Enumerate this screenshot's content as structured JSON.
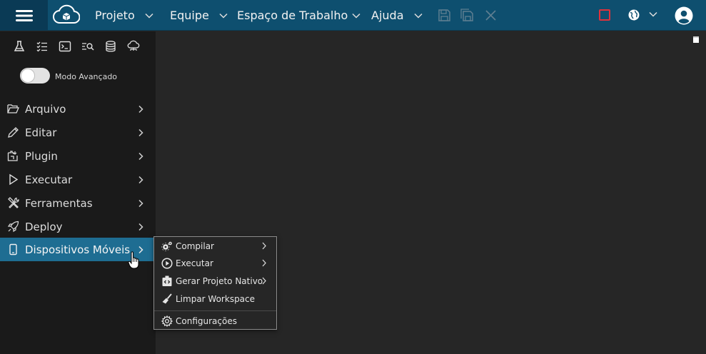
{
  "topbar": {
    "menus": [
      {
        "label": "Projeto"
      },
      {
        "label": "Equipe"
      },
      {
        "label": "Espaço de Trabalho"
      },
      {
        "label": "Ajuda"
      }
    ],
    "colors": {
      "bar": "#0e4f6f",
      "stop": "#e0313b"
    }
  },
  "toolbar_icons": [
    "flask-icon",
    "checklist-icon",
    "terminal-icon",
    "search-list-icon",
    "database-icon",
    "cloud-network-icon"
  ],
  "advanced_mode": {
    "label": "Modo Avançado",
    "enabled": false
  },
  "sidebar": {
    "items": [
      {
        "label": "Arquivo",
        "icon": "folder-open-icon"
      },
      {
        "label": "Editar",
        "icon": "pencil-icon"
      },
      {
        "label": "Plugin",
        "icon": "plugin-icon"
      },
      {
        "label": "Executar",
        "icon": "play-icon"
      },
      {
        "label": "Ferramentas",
        "icon": "tools-icon"
      },
      {
        "label": "Deploy",
        "icon": "rocket-icon"
      },
      {
        "label": "Dispositivos Móveis",
        "icon": "mobile-icon",
        "active": true
      }
    ],
    "active_color": "#1e6d92"
  },
  "submenu": {
    "items": [
      {
        "label": "Compilar",
        "icon": "gears-icon"
      },
      {
        "label": "Executar",
        "icon": "play-circle-icon"
      },
      {
        "label": "Gerar Projeto Nativo",
        "icon": "native-project-icon"
      },
      {
        "label": "Limpar Workspace",
        "icon": "broom-icon"
      },
      {
        "label": "Configurações",
        "icon": "gear-icon"
      }
    ]
  }
}
